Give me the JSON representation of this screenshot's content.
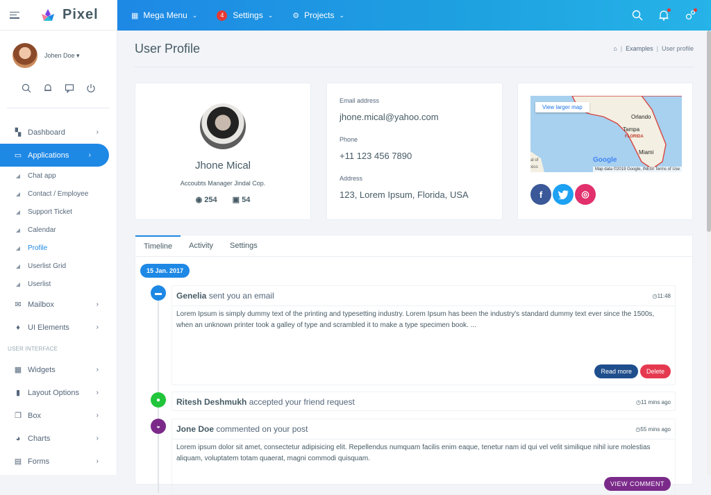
{
  "app": {
    "name": "Pixel"
  },
  "topnav": {
    "mega_menu": "Mega Menu",
    "settings": "Settings",
    "settings_badge": "4",
    "projects": "Projects"
  },
  "sidebar": {
    "user_name": "Johen Doe",
    "menu": [
      {
        "label": "Dashboard",
        "icon": "dashboard-icon"
      },
      {
        "label": "Applications",
        "icon": "app-icon",
        "active": true
      },
      {
        "label": "Chat app"
      },
      {
        "label": "Contact / Employee"
      },
      {
        "label": "Support Ticket"
      },
      {
        "label": "Calendar"
      },
      {
        "label": "Profile",
        "current": true
      },
      {
        "label": "Userlist Grid"
      },
      {
        "label": "Userlist"
      },
      {
        "label": "Mailbox",
        "icon": "mail-icon"
      },
      {
        "label": "UI Elements",
        "icon": "paint-icon"
      }
    ],
    "section": "USER INTERFACE",
    "menu2": [
      {
        "label": "Widgets",
        "icon": "widgets-icon"
      },
      {
        "label": "Layout Options",
        "icon": "layout-icon"
      },
      {
        "label": "Box",
        "icon": "box-icon"
      },
      {
        "label": "Charts",
        "icon": "chart-icon"
      },
      {
        "label": "Forms",
        "icon": "forms-icon"
      }
    ]
  },
  "page": {
    "title": "User Profile",
    "breadcrumb": [
      "Examples",
      "User profile"
    ]
  },
  "profile": {
    "name": "Jhone Mical",
    "role": "Accoubts Manager Jindal Cop.",
    "followers": "254",
    "photos": "54"
  },
  "contact": {
    "email_label": "Email address",
    "email": "jhone.mical@yahoo.com",
    "phone_label": "Phone",
    "phone": "+11 123 456 7890",
    "address_label": "Address",
    "address": "123, Lorem Ipsum, Florida, USA"
  },
  "map": {
    "link": "View larger map",
    "labels": [
      "Orlando",
      "Tampa",
      "FLORIDA",
      "Miami",
      "Google",
      "Map data ©2019 Google, INEGI",
      "Terms of Use",
      "al of",
      "xico"
    ]
  },
  "social": {
    "facebook": "f",
    "twitter": "t",
    "instagram": "◎",
    "colors": {
      "facebook": "#3b5998",
      "twitter": "#1da1f2",
      "instagram": "#e1306c"
    }
  },
  "tabs": [
    "Timeline",
    "Activity",
    "Settings"
  ],
  "timeline": {
    "date": "15 Jan. 2017",
    "events": [
      {
        "who": "Genelia",
        "what": "sent you an email",
        "time": "11:48",
        "body": "Lorem Ipsum is simply dummy text of the printing and typesetting industry. Lorem Ipsum has been the industry's standard dummy text ever since the 1500s, when an unknown printer took a galley of type and scrambled it to make a type specimen book. ...",
        "btn1": "Read more",
        "btn2": "Delete"
      },
      {
        "who": "Ritesh Deshmukh",
        "what": "accepted your friend request",
        "time": "11 mins ago"
      },
      {
        "who": "Jone Doe",
        "what": "commented on your post",
        "time": "55 mins ago",
        "body": "Lorem ipsum dolor sit amet, consectetur adipisicing elit. Repellendus numquam facilis enim eaque, tenetur nam id qui vel velit similique nihil iure molestias aliquam, voluptatem totam quaerat, magni commodi quisquam.",
        "btn1": "VIEW COMMENT"
      }
    ]
  },
  "colors": {
    "primary": "#1e88e5",
    "danger": "#e53935",
    "success": "#21c53b",
    "purple": "#7b2a8a",
    "navy": "#1f4e8c"
  }
}
